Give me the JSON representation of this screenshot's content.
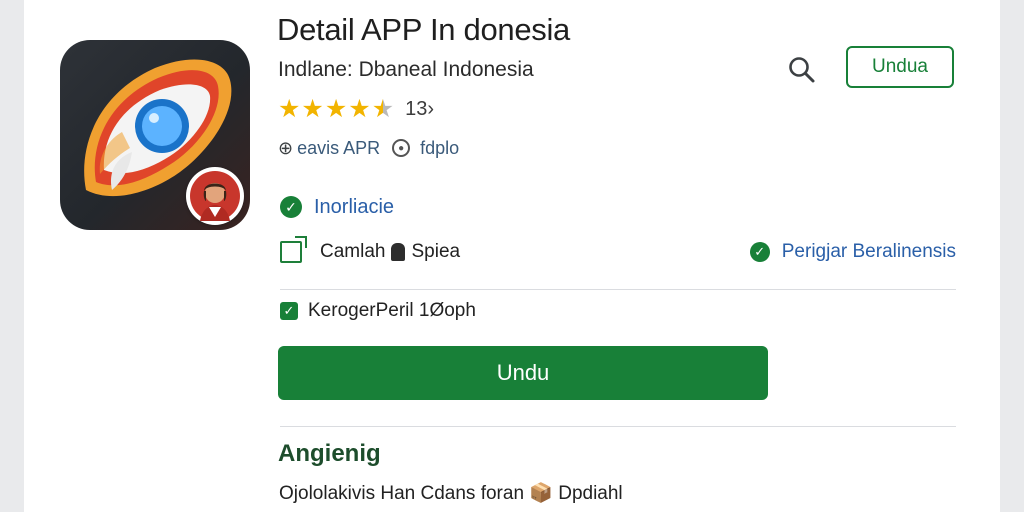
{
  "app": {
    "title": "Detail APP In donesia",
    "subtitle": "Indlane: Dbaneal Indonesia",
    "rating_count": "13›",
    "rating_value": 4.5,
    "meta_left": "eavis APR",
    "meta_right": "fdplo",
    "installed_label": "Inorliacie"
  },
  "header": {
    "outline_button_label": "Undua"
  },
  "features": {
    "left_text_1": "Camlah",
    "left_text_2": "Spiea",
    "right_text": "Perigjar Beralinensis",
    "checkbox_label": "KerogerPeril 1Øoph"
  },
  "actions": {
    "main_button_label": "Undu"
  },
  "about": {
    "section_title": "Angienig",
    "description": "Ojololakivis Han Cdans foran 📦 Dpdiahl"
  },
  "colors": {
    "accent_green": "#188038",
    "link_blue": "#2a5fa8",
    "star_gold": "#f2b400"
  },
  "icons": {
    "search": "search-icon",
    "share": "open-external-icon",
    "check": "check-circle-icon",
    "star": "star-icon"
  }
}
